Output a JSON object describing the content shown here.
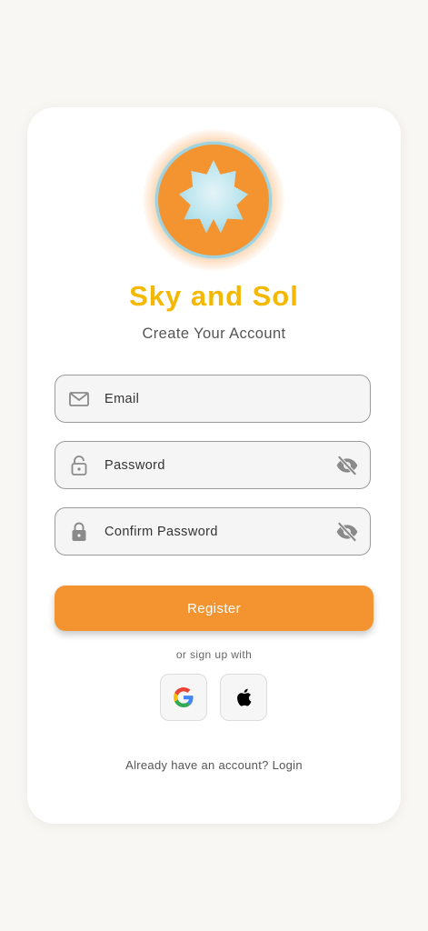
{
  "app": {
    "name": "Sky and Sol",
    "subtitle": "Create Your Account"
  },
  "form": {
    "email": {
      "placeholder": "Email",
      "value": ""
    },
    "password": {
      "placeholder": "Password",
      "value": ""
    },
    "confirm_password": {
      "placeholder": "Confirm Password",
      "value": ""
    },
    "register_label": "Register"
  },
  "social": {
    "divider_text": "or sign up with",
    "providers": [
      "google",
      "apple"
    ]
  },
  "footer": {
    "prompt": "Already have an account?",
    "login_label": "Login"
  },
  "icons": {
    "logo": "star-badge-icon",
    "email": "mail-icon",
    "password": "lock-open-icon",
    "confirm_password": "lock-icon",
    "toggle": "eye-off-icon",
    "google": "google-icon",
    "apple": "apple-icon"
  },
  "colors": {
    "background": "#f9f7f3",
    "card": "#ffffff",
    "brand_title": "#f5b800",
    "accent": "#f39431",
    "field_bg": "#f5f5f5",
    "field_border": "#9a9a9a",
    "logo_star": "#bfe6ef"
  }
}
